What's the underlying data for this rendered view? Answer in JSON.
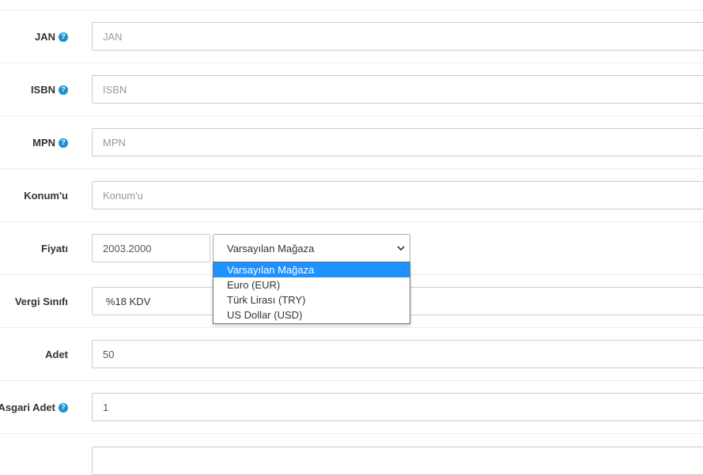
{
  "fields": {
    "jan": {
      "label": "JAN",
      "placeholder": "JAN",
      "value": ""
    },
    "isbn": {
      "label": "ISBN",
      "placeholder": "ISBN",
      "value": ""
    },
    "mpn": {
      "label": "MPN",
      "placeholder": "MPN",
      "value": ""
    },
    "location": {
      "label": "Konum'u",
      "placeholder": "Konum'u",
      "value": ""
    },
    "price": {
      "label": "Fiyatı",
      "value": "2003.2000",
      "currency_selected": "Varsayılan Mağaza",
      "currency_options": [
        "Varsayılan Mağaza",
        "Euro (EUR)",
        "Türk Lirası (TRY)",
        "US Dollar (USD)"
      ]
    },
    "tax_class": {
      "label": "Vergi Sınıfı",
      "value": "%18 KDV"
    },
    "quantity": {
      "label": "Adet",
      "value": "50"
    },
    "minimum": {
      "label": "Asgari Adet",
      "value": "1"
    }
  },
  "icons": {
    "help": "question-circle-icon",
    "chevron": "chevron-down-icon"
  },
  "help_glyph": "?",
  "colors": {
    "help_icon": "#1e91cf",
    "dropdown_highlight": "#1e90ff",
    "row_divider": "#ececec"
  }
}
